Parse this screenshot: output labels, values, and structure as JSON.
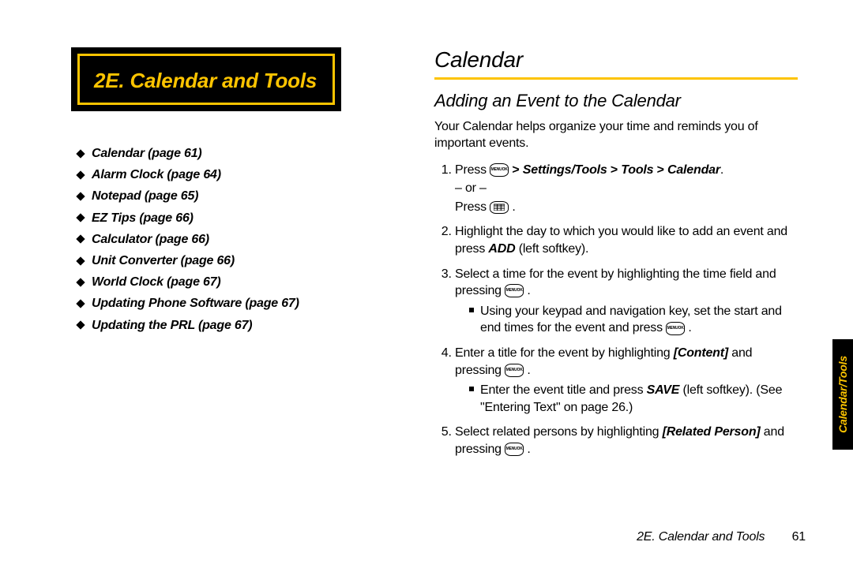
{
  "section": {
    "number_title": "2E.  Calendar and Tools"
  },
  "toc": [
    "Calendar (page 61)",
    "Alarm Clock (page 64)",
    "Notepad (page 65)",
    "EZ Tips (page 66)",
    "Calculator (page 66)",
    "Unit Converter (page 66)",
    "World Clock (page 67)",
    "Updating Phone Software (page 67)",
    "Updating the PRL (page 67)"
  ],
  "right": {
    "heading": "Calendar",
    "subheading": "Adding an Event to the Calendar",
    "intro": "Your Calendar helps organize your time and reminds you of important events.",
    "step1": {
      "press": "Press ",
      "path_prefix": "Settings/Tools",
      "path_mid": "Tools",
      "path_end": "Calendar",
      "or": "– or –",
      "press2": "Press "
    },
    "step2": {
      "a": "Highlight the day to which you would like to add an event and press ",
      "add": "ADD",
      "b": " (left softkey)."
    },
    "step3": {
      "a": "Select a time for the event by highlighting the time field and pressing ",
      "sub_a": "Using your keypad and navigation key, set the start and end times for the event and press "
    },
    "step4": {
      "a": "Enter a title for the event by highlighting ",
      "content": "[Content]",
      "b": " and pressing ",
      "sub_a": "Enter the event title and press ",
      "save": "SAVE",
      "sub_b": " (left softkey). (See \"Entering Text\" on page 26.)"
    },
    "step5": {
      "a": "Select related persons by highlighting ",
      "related": "[Related Person]",
      "b": " and pressing "
    }
  },
  "footer": {
    "label": "2E. Calendar and Tools",
    "page": "61"
  },
  "side_tab": "Calendar/Tools",
  "key_labels": {
    "menu": "MENU",
    "ok": "OK"
  }
}
